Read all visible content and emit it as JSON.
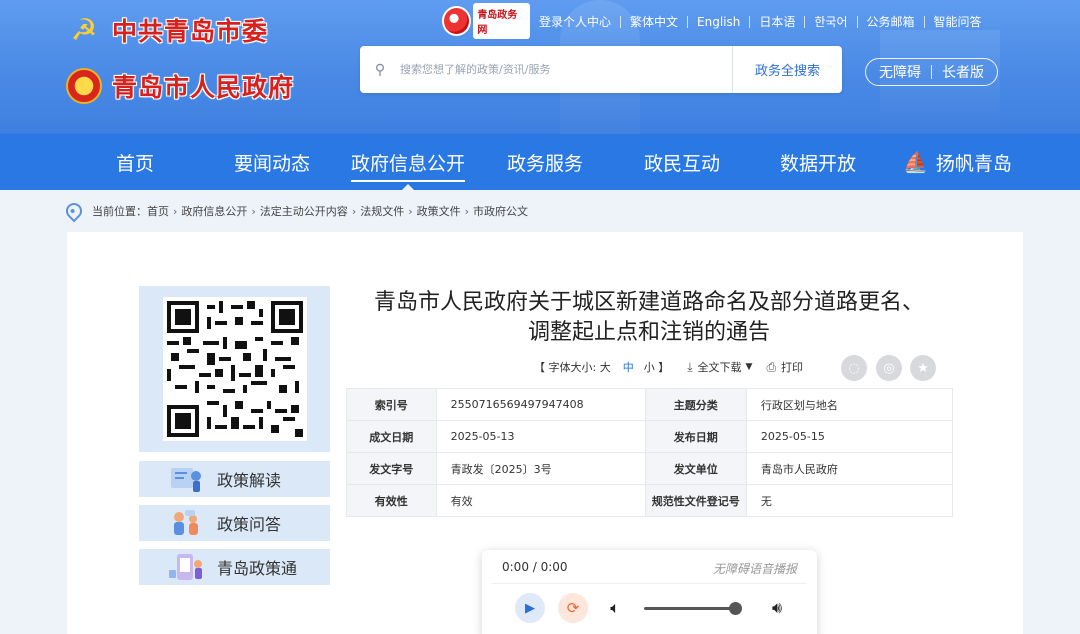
{
  "header": {
    "brand_party": "中共青岛市委",
    "brand_gov": "青岛市人民政府",
    "portal_logo_text": "青岛政务网",
    "top_links": [
      "登录个人中心",
      "繁体中文",
      "English",
      "日本语",
      "한국어",
      "公务邮箱",
      "智能问答"
    ],
    "search": {
      "placeholder": "搜索您想了解的政策/资讯/服务",
      "button": "政务全搜索"
    },
    "accessibility": {
      "barrier_free": "无障碍",
      "elderly": "长者版"
    }
  },
  "nav": {
    "items": [
      "首页",
      "要闻动态",
      "政府信息公开",
      "政务服务",
      "政民互动",
      "数据开放",
      "扬帆青岛"
    ],
    "active_index": 2
  },
  "breadcrumb": {
    "prefix": "当前位置：",
    "items": [
      "首页",
      "政府信息公开",
      "法定主动公开内容",
      "法规文件",
      "政策文件",
      "市政府公文"
    ]
  },
  "sidebar": {
    "links": [
      "政策解读",
      "政策问答",
      "青岛政策通"
    ]
  },
  "article": {
    "title_line1": "青岛市人民政府关于城区新建道路命名及部分道路更名、",
    "title_line2": "调整起止点和注销的通告",
    "tools": {
      "font_size_label": "【 字体大小: 大",
      "font_mid": "中",
      "font_small": "小 】",
      "download": "全文下载",
      "print": "打印"
    },
    "meta": [
      {
        "label": "索引号",
        "value": "2550716569497947408",
        "label2": "主题分类",
        "value2": "行政区划与地名"
      },
      {
        "label": "成文日期",
        "value": "2025-05-13",
        "label2": "发布日期",
        "value2": "2025-05-15"
      },
      {
        "label": "发文字号",
        "value": "青政发〔2025〕3号",
        "label2": "发文单位",
        "value2": "青岛市人民政府"
      },
      {
        "label": "有效性",
        "value": "有效",
        "label2": "规范性文件登记号",
        "value2": "无"
      }
    ]
  },
  "player": {
    "time": "0:00 / 0:00",
    "label": "无障碍语音播报",
    "volume_level": 0.95
  },
  "colors": {
    "nav_bg": "#2a78e4",
    "header_bg": "#4a8ae6",
    "brand_red": "#d8201c",
    "side_bg": "#dbe8f8"
  }
}
